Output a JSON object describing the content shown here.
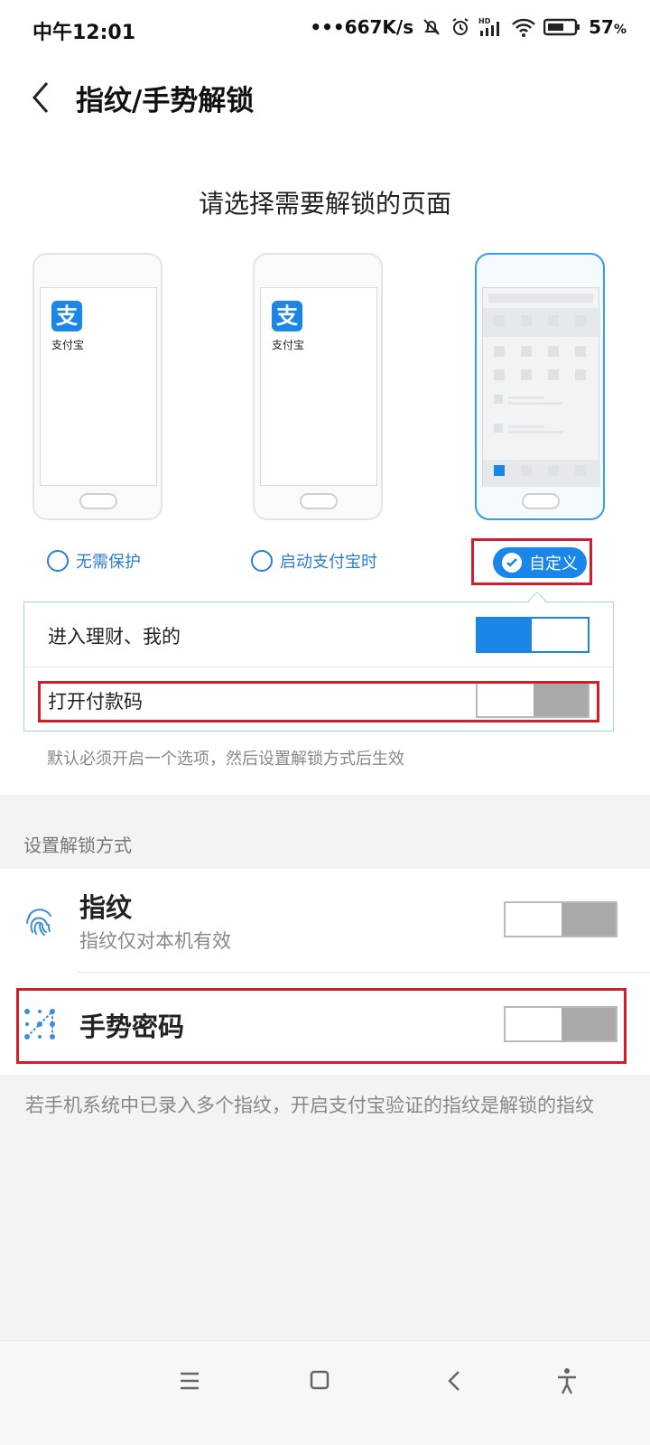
{
  "status": {
    "time": "中午12:01",
    "speed": "•••667K/s",
    "battery": "57",
    "battery_unit": "%"
  },
  "header": {
    "title": "指纹/手势解锁"
  },
  "select_title": "请选择需要解锁的页面",
  "phones": [
    {
      "app_name": "支付宝",
      "app_glyph": "支"
    },
    {
      "app_name": "支付宝",
      "app_glyph": "支"
    }
  ],
  "options": [
    {
      "label": "无需保护",
      "selected": false
    },
    {
      "label": "启动支付宝时",
      "selected": false
    },
    {
      "label": "自定义",
      "selected": true
    }
  ],
  "custom_items": [
    {
      "label": "进入理财、我的",
      "on": true
    },
    {
      "label": "打开付款码",
      "on": false
    }
  ],
  "custom_hint": "默认必须开启一个选项，然后设置解锁方式后生效",
  "unlock_section_label": "设置解锁方式",
  "methods": [
    {
      "title": "指纹",
      "subtitle": "指纹仅对本机有效",
      "icon": "fingerprint-icon",
      "on": false
    },
    {
      "title": "手势密码",
      "icon": "gesture-pattern-icon",
      "on": false
    }
  ],
  "footer_hint": "若手机系统中已录入多个指纹，开启支付宝验证的指纹是解锁的指纹",
  "colors": {
    "accent": "#1a86e8",
    "highlight_box": "#d21d2a",
    "toggle_off": "#a9a9a9"
  }
}
